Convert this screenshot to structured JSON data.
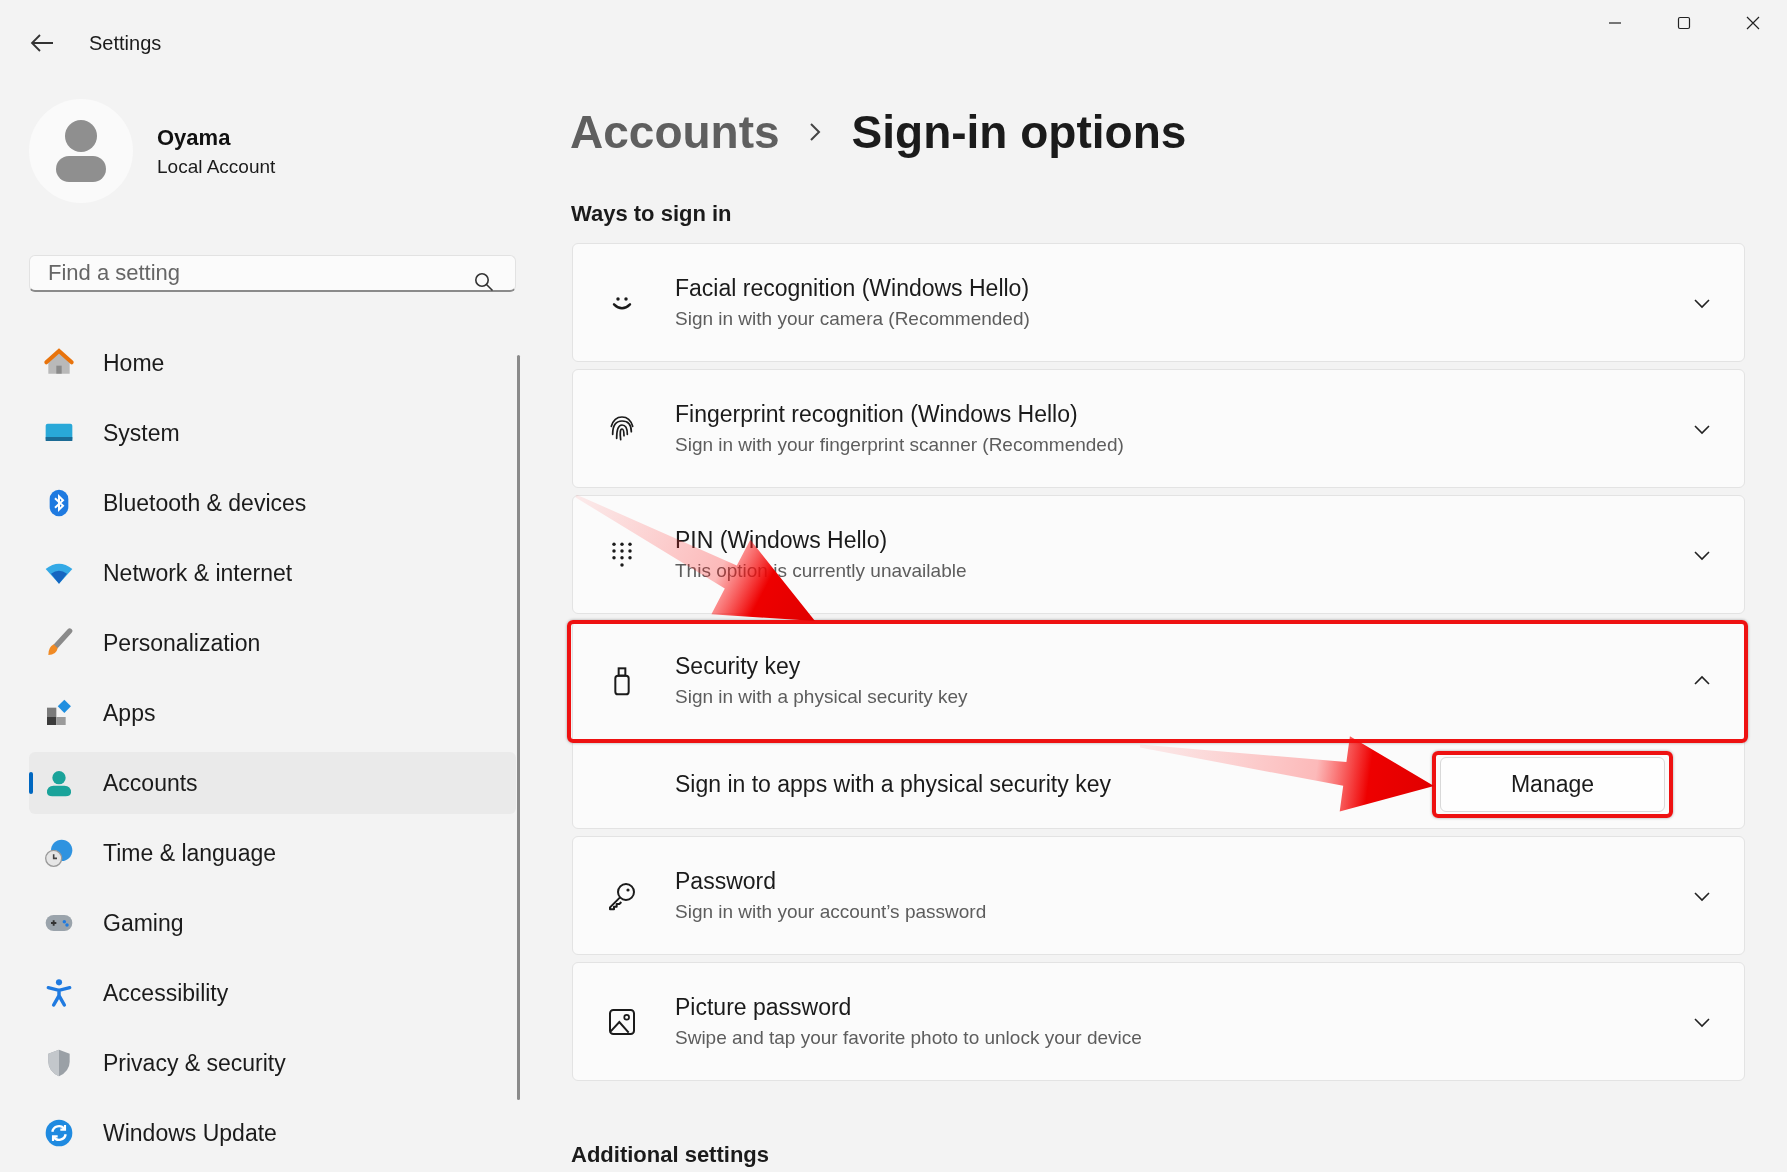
{
  "window": {
    "title": "Settings"
  },
  "profile": {
    "name": "Oyama",
    "account_type": "Local Account"
  },
  "search": {
    "placeholder": "Find a setting"
  },
  "nav": {
    "items": [
      {
        "label": "Home",
        "selected": false
      },
      {
        "label": "System",
        "selected": false
      },
      {
        "label": "Bluetooth & devices",
        "selected": false
      },
      {
        "label": "Network & internet",
        "selected": false
      },
      {
        "label": "Personalization",
        "selected": false
      },
      {
        "label": "Apps",
        "selected": false
      },
      {
        "label": "Accounts",
        "selected": true
      },
      {
        "label": "Time & language",
        "selected": false
      },
      {
        "label": "Gaming",
        "selected": false
      },
      {
        "label": "Accessibility",
        "selected": false
      },
      {
        "label": "Privacy & security",
        "selected": false
      },
      {
        "label": "Windows Update",
        "selected": false
      }
    ]
  },
  "header": {
    "parent": "Accounts",
    "title": "Sign-in options"
  },
  "ways": {
    "title": "Ways to sign in",
    "cards": [
      {
        "title": "Facial recognition (Windows Hello)",
        "subtitle": "Sign in with your camera (Recommended)",
        "expanded": false,
        "highlighted": false
      },
      {
        "title": "Fingerprint recognition (Windows Hello)",
        "subtitle": "Sign in with your fingerprint scanner (Recommended)",
        "expanded": false,
        "highlighted": false
      },
      {
        "title": "PIN (Windows Hello)",
        "subtitle": "This option is currently unavailable",
        "expanded": false,
        "highlighted": false
      },
      {
        "title": "Security key",
        "subtitle": "Sign in with a physical security key",
        "expanded": true,
        "highlighted": true,
        "detail": {
          "text": "Sign in to apps with a physical security key",
          "button": "Manage",
          "button_highlighted": true
        }
      },
      {
        "title": "Password",
        "subtitle": "Sign in with your account’s password",
        "expanded": false,
        "highlighted": false
      },
      {
        "title": "Picture password",
        "subtitle": "Swipe and tap your favorite photo to unlock your device",
        "expanded": false,
        "highlighted": false
      }
    ]
  },
  "additional": {
    "title": "Additional settings"
  }
}
